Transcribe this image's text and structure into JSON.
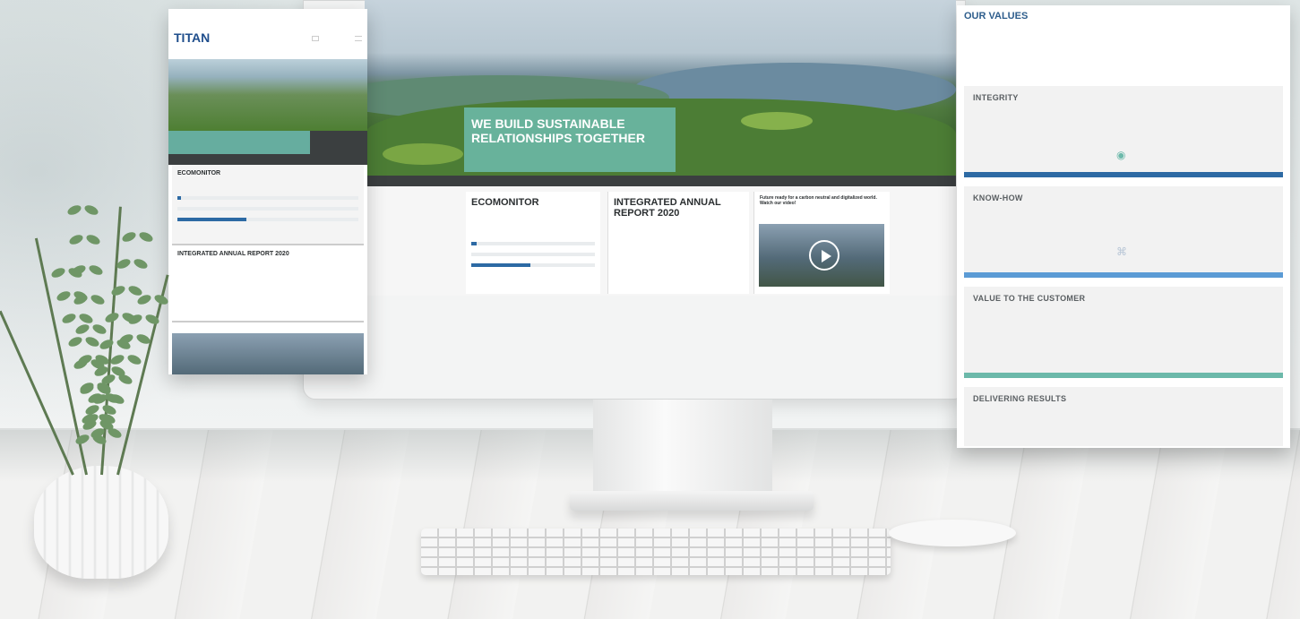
{
  "desktop": {
    "hero_title": "WE BUILD SUSTAINABLE RELATIONSHIPS TOGETHER",
    "cards": {
      "ecomonitor": {
        "title": "ECOMONITOR"
      },
      "annual_report": {
        "title": "INTEGRATED ANNUAL REPORT 2020"
      },
      "video": {
        "title": "Future ready for a carbon neutral and digitalized world. Watch our video!"
      }
    }
  },
  "phone": {
    "logo": "TITAN",
    "sections": {
      "ecomonitor": "ECOMONITOR",
      "annual_report": "INTEGRATED ANNUAL REPORT 2020"
    }
  },
  "values_panel": {
    "title": "OUR VALUES",
    "items": [
      {
        "name": "INTEGRITY",
        "color": "#2d6aa4"
      },
      {
        "name": "KNOW-HOW",
        "color": "#5b9bd5"
      },
      {
        "name": "VALUE TO THE CUSTOMER",
        "color": "#6cb9aa"
      },
      {
        "name": "DELIVERING RESULTS",
        "color": "#2d6aa4"
      }
    ]
  },
  "colors": {
    "accent_teal": "#6cb9aa",
    "accent_blue": "#2d6aa4",
    "brand": "#1f4e8c"
  }
}
